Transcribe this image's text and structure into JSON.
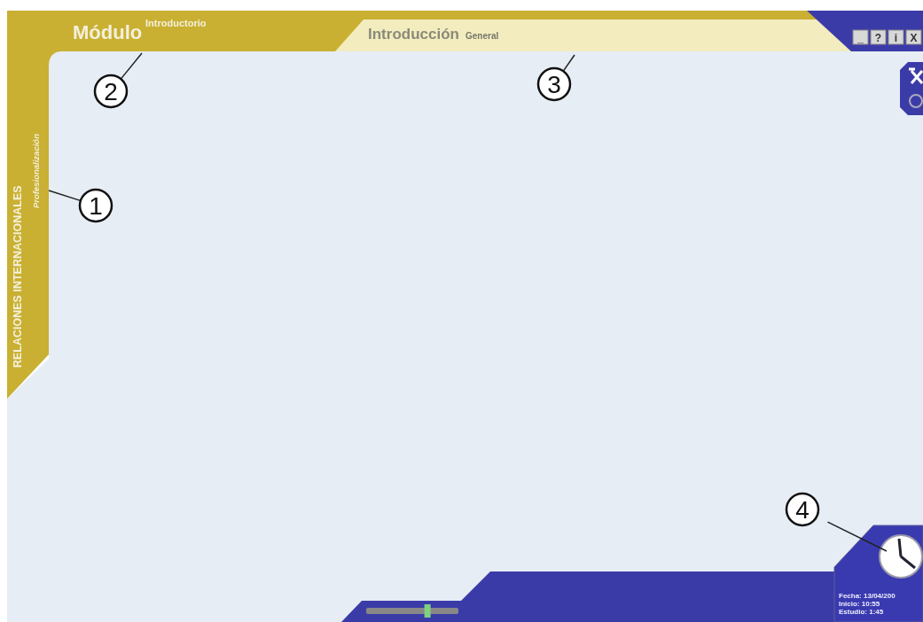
{
  "module": {
    "title": "Módulo",
    "subtitle": "Introductorio"
  },
  "section": {
    "title": "Introducción",
    "subtitle": "General"
  },
  "course": {
    "title": "RELACIONES INTERNACIONALES",
    "subtitle": "Profesionalización"
  },
  "window_buttons": [
    "_",
    "?",
    "i",
    "X"
  ],
  "callouts": [
    "1",
    "2",
    "3",
    "4"
  ],
  "volume": {
    "level": 0.66
  },
  "session": [
    "Fecha: 13/04/200",
    "Inicio: 10:55",
    "Estudio: 1:45"
  ]
}
